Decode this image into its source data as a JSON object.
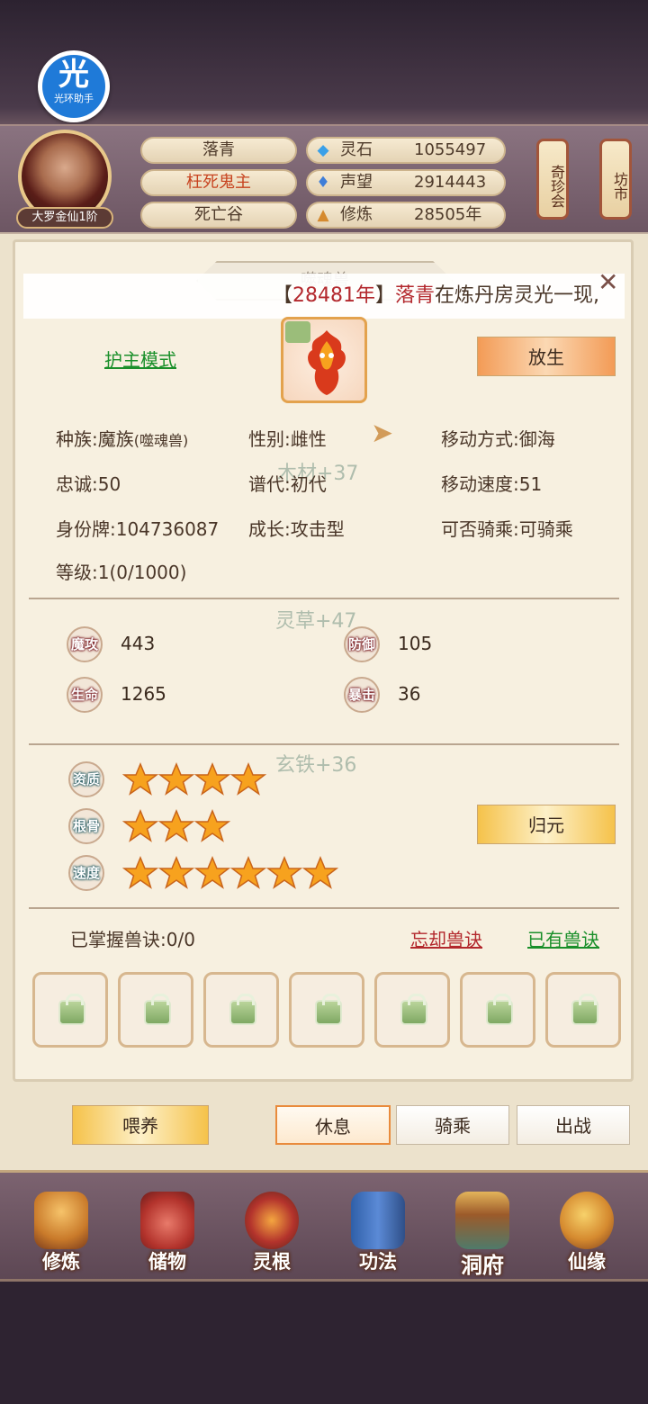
{
  "app": {
    "badge_big": "光",
    "badge_small": "光环助手"
  },
  "player": {
    "realm": "大罗金仙1阶",
    "name": "落青",
    "title": "枉死鬼主",
    "location": "死亡谷",
    "resources": [
      {
        "icon": "spirit-stone-icon",
        "label": "灵石",
        "value": "1055497"
      },
      {
        "icon": "reputation-icon",
        "label": "声望",
        "value": "2914443"
      },
      {
        "icon": "cultivation-icon",
        "label": "修炼",
        "value": "28505年"
      }
    ]
  },
  "lanterns": {
    "treasure": "奇珍会",
    "market": "坊市"
  },
  "pet": {
    "name": "噬魂兽",
    "broadcast_year": "28481年",
    "broadcast_name": "落青",
    "broadcast_tail": "在炼丹房灵光一现,",
    "mode_link": "护主模式",
    "release_button": "放生",
    "info": {
      "race_label": "种族:",
      "race_value": "魔族",
      "race_sub": "(噬魂兽)",
      "gender": "性别:雌性",
      "move_mode": "移动方式:御海",
      "loyalty": "忠诚:50",
      "generation": "谱代:初代",
      "move_speed": "移动速度:51",
      "id_tag": "身份牌:104736087",
      "growth": "成长:攻击型",
      "rideable": "可否骑乘:可骑乘",
      "level": "等级:1(0/1000)"
    },
    "watermarks": {
      "wood": "木材+37",
      "herb": "灵草+47",
      "iron": "玄铁+36"
    },
    "stats": {
      "m_atk_label": "魔攻",
      "m_atk": "443",
      "def_label": "防御",
      "def": "105",
      "hp_label": "生命",
      "hp": "1265",
      "crit_label": "暴击",
      "crit": "36"
    },
    "ratings": [
      {
        "label": "资质",
        "stars": 4
      },
      {
        "label": "根骨",
        "stars": 3
      },
      {
        "label": "速度",
        "stars": 6
      }
    ],
    "reset_button": "归元",
    "skills_mastered": "已掌握兽诀:0/0",
    "forget_link": "忘却兽诀",
    "owned_link": "已有兽诀",
    "skill_slots": 7
  },
  "actions": {
    "feed": "喂养",
    "rest": "休息",
    "ride": "骑乘",
    "battle": "出战"
  },
  "nav": [
    "修炼",
    "储物",
    "灵根",
    "功法",
    "洞府",
    "仙缘"
  ],
  "colors": {
    "accent_orange": "#f39b56",
    "gold": "#f5c24a",
    "link_green": "#1a8f2a",
    "link_red": "#b3282d",
    "panel_bg": "#f7f0e0"
  }
}
